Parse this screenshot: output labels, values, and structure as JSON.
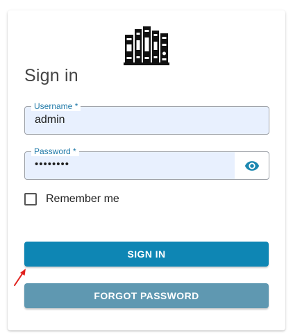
{
  "login": {
    "title": "Sign in",
    "username": {
      "label": "Username *",
      "value": "admin"
    },
    "password": {
      "label": "Password *",
      "value": "••••••••"
    },
    "remember_label": "Remember me",
    "remember_checked": false,
    "signin_label": "SIGN IN",
    "forgot_label": "FORGOT PASSWORD"
  },
  "icons": {
    "logo": "books-logo-icon",
    "password_toggle": "eye-icon",
    "annotation": "red-arrow-pointer"
  },
  "colors": {
    "primary": "#0e86b4",
    "secondary_button": "#5f98b1",
    "label": "#1f79a8",
    "autofill_bg": "#e8f0fe",
    "annotation": "#e0201c"
  }
}
